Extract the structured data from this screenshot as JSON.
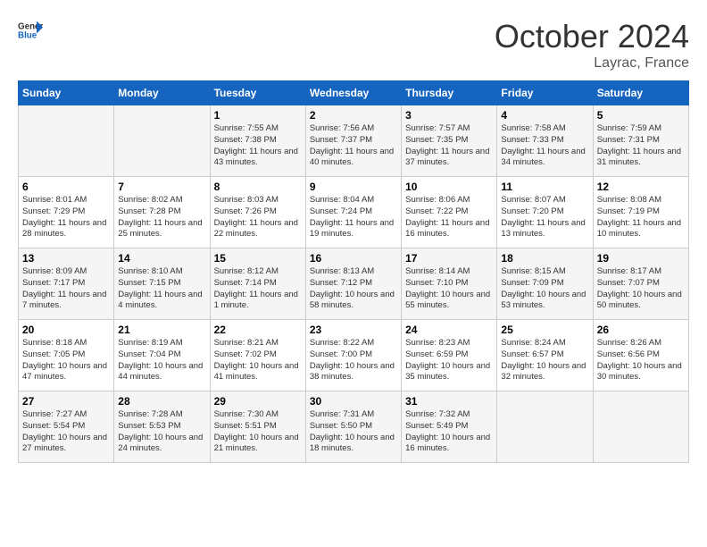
{
  "header": {
    "logo_general": "General",
    "logo_blue": "Blue",
    "month_title": "October 2024",
    "location": "Layrac, France"
  },
  "days_of_week": [
    "Sunday",
    "Monday",
    "Tuesday",
    "Wednesday",
    "Thursday",
    "Friday",
    "Saturday"
  ],
  "weeks": [
    [
      {
        "day": "",
        "sunrise": "",
        "sunset": "",
        "daylight": ""
      },
      {
        "day": "",
        "sunrise": "",
        "sunset": "",
        "daylight": ""
      },
      {
        "day": "1",
        "sunrise": "Sunrise: 7:55 AM",
        "sunset": "Sunset: 7:38 PM",
        "daylight": "Daylight: 11 hours and 43 minutes."
      },
      {
        "day": "2",
        "sunrise": "Sunrise: 7:56 AM",
        "sunset": "Sunset: 7:37 PM",
        "daylight": "Daylight: 11 hours and 40 minutes."
      },
      {
        "day": "3",
        "sunrise": "Sunrise: 7:57 AM",
        "sunset": "Sunset: 7:35 PM",
        "daylight": "Daylight: 11 hours and 37 minutes."
      },
      {
        "day": "4",
        "sunrise": "Sunrise: 7:58 AM",
        "sunset": "Sunset: 7:33 PM",
        "daylight": "Daylight: 11 hours and 34 minutes."
      },
      {
        "day": "5",
        "sunrise": "Sunrise: 7:59 AM",
        "sunset": "Sunset: 7:31 PM",
        "daylight": "Daylight: 11 hours and 31 minutes."
      }
    ],
    [
      {
        "day": "6",
        "sunrise": "Sunrise: 8:01 AM",
        "sunset": "Sunset: 7:29 PM",
        "daylight": "Daylight: 11 hours and 28 minutes."
      },
      {
        "day": "7",
        "sunrise": "Sunrise: 8:02 AM",
        "sunset": "Sunset: 7:28 PM",
        "daylight": "Daylight: 11 hours and 25 minutes."
      },
      {
        "day": "8",
        "sunrise": "Sunrise: 8:03 AM",
        "sunset": "Sunset: 7:26 PM",
        "daylight": "Daylight: 11 hours and 22 minutes."
      },
      {
        "day": "9",
        "sunrise": "Sunrise: 8:04 AM",
        "sunset": "Sunset: 7:24 PM",
        "daylight": "Daylight: 11 hours and 19 minutes."
      },
      {
        "day": "10",
        "sunrise": "Sunrise: 8:06 AM",
        "sunset": "Sunset: 7:22 PM",
        "daylight": "Daylight: 11 hours and 16 minutes."
      },
      {
        "day": "11",
        "sunrise": "Sunrise: 8:07 AM",
        "sunset": "Sunset: 7:20 PM",
        "daylight": "Daylight: 11 hours and 13 minutes."
      },
      {
        "day": "12",
        "sunrise": "Sunrise: 8:08 AM",
        "sunset": "Sunset: 7:19 PM",
        "daylight": "Daylight: 11 hours and 10 minutes."
      }
    ],
    [
      {
        "day": "13",
        "sunrise": "Sunrise: 8:09 AM",
        "sunset": "Sunset: 7:17 PM",
        "daylight": "Daylight: 11 hours and 7 minutes."
      },
      {
        "day": "14",
        "sunrise": "Sunrise: 8:10 AM",
        "sunset": "Sunset: 7:15 PM",
        "daylight": "Daylight: 11 hours and 4 minutes."
      },
      {
        "day": "15",
        "sunrise": "Sunrise: 8:12 AM",
        "sunset": "Sunset: 7:14 PM",
        "daylight": "Daylight: 11 hours and 1 minute."
      },
      {
        "day": "16",
        "sunrise": "Sunrise: 8:13 AM",
        "sunset": "Sunset: 7:12 PM",
        "daylight": "Daylight: 10 hours and 58 minutes."
      },
      {
        "day": "17",
        "sunrise": "Sunrise: 8:14 AM",
        "sunset": "Sunset: 7:10 PM",
        "daylight": "Daylight: 10 hours and 55 minutes."
      },
      {
        "day": "18",
        "sunrise": "Sunrise: 8:15 AM",
        "sunset": "Sunset: 7:09 PM",
        "daylight": "Daylight: 10 hours and 53 minutes."
      },
      {
        "day": "19",
        "sunrise": "Sunrise: 8:17 AM",
        "sunset": "Sunset: 7:07 PM",
        "daylight": "Daylight: 10 hours and 50 minutes."
      }
    ],
    [
      {
        "day": "20",
        "sunrise": "Sunrise: 8:18 AM",
        "sunset": "Sunset: 7:05 PM",
        "daylight": "Daylight: 10 hours and 47 minutes."
      },
      {
        "day": "21",
        "sunrise": "Sunrise: 8:19 AM",
        "sunset": "Sunset: 7:04 PM",
        "daylight": "Daylight: 10 hours and 44 minutes."
      },
      {
        "day": "22",
        "sunrise": "Sunrise: 8:21 AM",
        "sunset": "Sunset: 7:02 PM",
        "daylight": "Daylight: 10 hours and 41 minutes."
      },
      {
        "day": "23",
        "sunrise": "Sunrise: 8:22 AM",
        "sunset": "Sunset: 7:00 PM",
        "daylight": "Daylight: 10 hours and 38 minutes."
      },
      {
        "day": "24",
        "sunrise": "Sunrise: 8:23 AM",
        "sunset": "Sunset: 6:59 PM",
        "daylight": "Daylight: 10 hours and 35 minutes."
      },
      {
        "day": "25",
        "sunrise": "Sunrise: 8:24 AM",
        "sunset": "Sunset: 6:57 PM",
        "daylight": "Daylight: 10 hours and 32 minutes."
      },
      {
        "day": "26",
        "sunrise": "Sunrise: 8:26 AM",
        "sunset": "Sunset: 6:56 PM",
        "daylight": "Daylight: 10 hours and 30 minutes."
      }
    ],
    [
      {
        "day": "27",
        "sunrise": "Sunrise: 7:27 AM",
        "sunset": "Sunset: 5:54 PM",
        "daylight": "Daylight: 10 hours and 27 minutes."
      },
      {
        "day": "28",
        "sunrise": "Sunrise: 7:28 AM",
        "sunset": "Sunset: 5:53 PM",
        "daylight": "Daylight: 10 hours and 24 minutes."
      },
      {
        "day": "29",
        "sunrise": "Sunrise: 7:30 AM",
        "sunset": "Sunset: 5:51 PM",
        "daylight": "Daylight: 10 hours and 21 minutes."
      },
      {
        "day": "30",
        "sunrise": "Sunrise: 7:31 AM",
        "sunset": "Sunset: 5:50 PM",
        "daylight": "Daylight: 10 hours and 18 minutes."
      },
      {
        "day": "31",
        "sunrise": "Sunrise: 7:32 AM",
        "sunset": "Sunset: 5:49 PM",
        "daylight": "Daylight: 10 hours and 16 minutes."
      },
      {
        "day": "",
        "sunrise": "",
        "sunset": "",
        "daylight": ""
      },
      {
        "day": "",
        "sunrise": "",
        "sunset": "",
        "daylight": ""
      }
    ]
  ]
}
